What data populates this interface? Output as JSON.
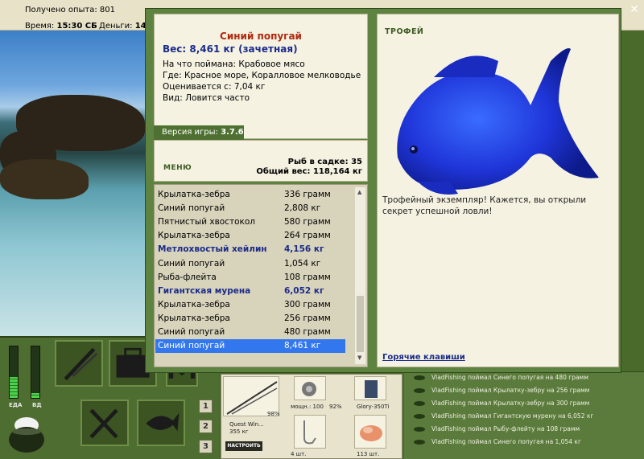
{
  "topbar": {
    "xp_label": "Получено опыта:",
    "xp_value": "801",
    "time_label": "Время:",
    "time_value": "15:30 СБ",
    "money_label": "Деньги:",
    "money_value": "14"
  },
  "catch": {
    "fish_name": "Синий попугай",
    "weight_line": "Вес: 8,461 кг (зачетная)",
    "bait_line": "На что поймана: Крабовое мясо",
    "place_line": "Где: Красное море, Коралловое мелководье",
    "value_line": "Оценивается с: 7,04 кг",
    "kind_line": "Вид: Ловится часто"
  },
  "version": {
    "label": "Версия игры:",
    "value": "3.7.6"
  },
  "summary": {
    "menu": "МЕНЮ",
    "net_line": "Рыб в садке: 35",
    "total_line": "Общий вес: 118,164 кг"
  },
  "fish_list": [
    {
      "name": "Крылатка-зебра",
      "weight": "336 грамм",
      "trophy": false,
      "selected": false
    },
    {
      "name": "Синий попугай",
      "weight": "2,808 кг",
      "trophy": false,
      "selected": false
    },
    {
      "name": "Пятнистый хвостокол",
      "weight": "580 грамм",
      "trophy": false,
      "selected": false
    },
    {
      "name": "Крылатка-зебра",
      "weight": "264 грамм",
      "trophy": false,
      "selected": false
    },
    {
      "name": "Метлохвостый хейлин",
      "weight": "4,156 кг",
      "trophy": true,
      "selected": false
    },
    {
      "name": "Синий попугай",
      "weight": "1,054 кг",
      "trophy": false,
      "selected": false
    },
    {
      "name": "Рыба-флейта",
      "weight": "108 грамм",
      "trophy": false,
      "selected": false
    },
    {
      "name": "Гигантская мурена",
      "weight": "6,052 кг",
      "trophy": true,
      "selected": false
    },
    {
      "name": "Крылатка-зебра",
      "weight": "300 грамм",
      "trophy": false,
      "selected": false
    },
    {
      "name": "Крылатка-зебра",
      "weight": "256 грамм",
      "trophy": false,
      "selected": false
    },
    {
      "name": "Синий попугай",
      "weight": "480 грамм",
      "trophy": false,
      "selected": false
    },
    {
      "name": "Синий попугай",
      "weight": "8,461 кг",
      "trophy": false,
      "selected": true
    }
  ],
  "trophy": {
    "label": "ТРОФЕЙ",
    "description": "Трофейный экземпляр! Кажется, вы открыли секрет успешной ловли!",
    "hotkeys": "Горячие клавиши"
  },
  "meters": {
    "food_label": "ЕДА",
    "sleep_label": "ВД",
    "food_level": 0.4,
    "sleep_level": 0.1
  },
  "bottom_buttons": [
    "1",
    "2",
    "3"
  ],
  "tackle": {
    "rod_name": "Quest Win...",
    "rod_weight": "355 кг",
    "rod_percent": "98%",
    "reel_label": "мощн.: 100",
    "reel_percent": "92%",
    "line_name": "Glory-350Ti",
    "hook_count": "4 шт.",
    "bait_count": "113 шт.",
    "setup_button": "НАСТРОИТЬ"
  },
  "log": [
    "VladFishing поймал Синего попугая на 480 грамм",
    "VladFishing поймал Крылатку-зебру на 256 грамм",
    "VladFishing поймал Крылатку-зебру на 300 грамм",
    "VladFishing поймал Гигантскую мурену на 6,052 кг",
    "VladFishing поймал Рыбу-флейту на 108 грамм",
    "VladFishing поймал Синего попугая на 1,054 кг"
  ],
  "colors": {
    "accent_green": "#5e8240",
    "trophy_blue": "#1b2b8a",
    "title_red": "#b02a10",
    "selection": "#3377ee"
  }
}
